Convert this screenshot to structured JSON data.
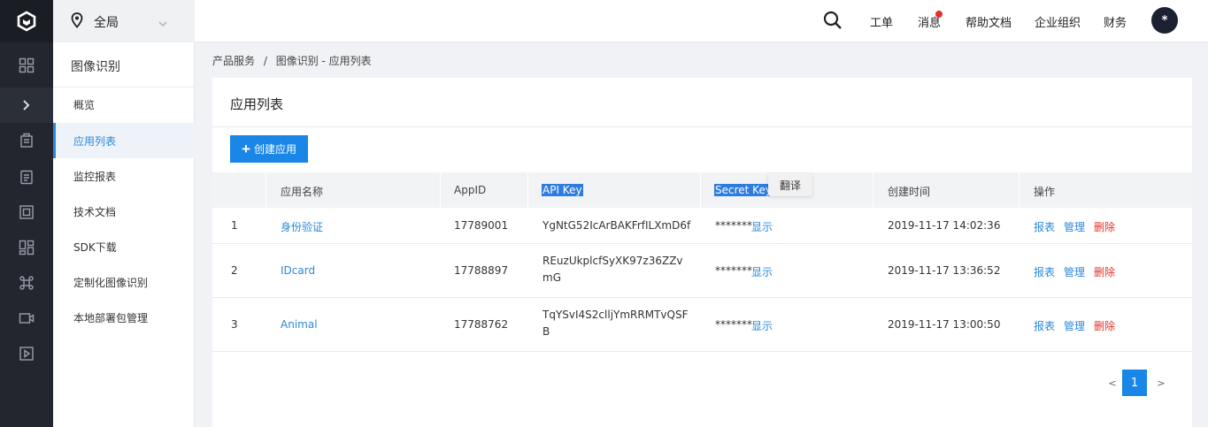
{
  "topbar": {
    "region": "全局",
    "nav": [
      "工单",
      "消息",
      "帮助文档",
      "企业组织",
      "财务"
    ],
    "avatar": "*",
    "message_dot_color": "#e5302a"
  },
  "rail": {
    "icons": [
      "logo-icon",
      "grid-icon",
      "chevron-right-icon",
      "building-icon",
      "clipboard-icon",
      "frame-icon",
      "dashboard-icon",
      "command-icon",
      "video-icon",
      "play-icon"
    ]
  },
  "sidebar": {
    "title": "图像识别",
    "items": [
      {
        "label": "概览"
      },
      {
        "label": "应用列表",
        "active": true
      },
      {
        "label": "监控报表"
      },
      {
        "label": "技术文档"
      },
      {
        "label": "SDK下载"
      },
      {
        "label": "定制化图像识别"
      },
      {
        "label": "本地部署包管理"
      }
    ]
  },
  "breadcrumb": {
    "root": "产品服务",
    "separator": "/",
    "current": "图像识别 - 应用列表"
  },
  "card": {
    "title": "应用列表",
    "create_button": "创建应用",
    "tooltip": "翻译"
  },
  "table": {
    "headers": [
      "",
      "应用名称",
      "AppID",
      "API Key",
      "Secret Key",
      "创建时间",
      "操作"
    ],
    "rows": [
      {
        "index": "1",
        "name": "身份验证",
        "appid": "17789001",
        "apikey": "YgNtG52IcArBAKFrfILXmD6f",
        "secret": "*******",
        "show": "显示",
        "time": "2019-11-17 14:02:36",
        "ops": [
          "报表",
          "管理",
          "删除"
        ]
      },
      {
        "index": "2",
        "name": "IDcard",
        "appid": "17788897",
        "apikey": "REuzUkplcfSyXK97z36ZZvmG",
        "secret": "*******",
        "show": "显示",
        "time": "2019-11-17 13:36:52",
        "ops": [
          "报表",
          "管理",
          "删除"
        ]
      },
      {
        "index": "3",
        "name": "Animal",
        "appid": "17788762",
        "apikey": "TqYSvI4S2clljYmRRMTvQSFB",
        "secret": "*******",
        "show": "显示",
        "time": "2019-11-17 13:00:50",
        "ops": [
          "报表",
          "管理",
          "删除"
        ]
      }
    ]
  },
  "pagination": {
    "prev": "<",
    "current": "1",
    "next": ">"
  },
  "colors": {
    "accent": "#1a87e8",
    "link": "#2b88d8",
    "danger": "#e5302a",
    "rail": "#23262e"
  }
}
